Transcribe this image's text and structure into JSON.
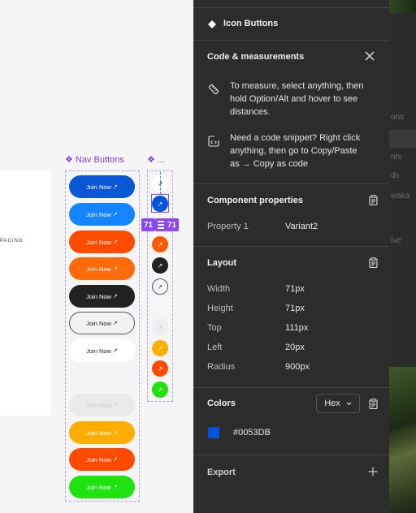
{
  "canvas": {
    "spacing_label": "PACING",
    "nav_frame_label": "Nav Buttons",
    "icon_frame_label": "...",
    "frame_glyph": "❖",
    "nav_buttons": [
      {
        "label": "Join Now",
        "bg": "#0a57d6",
        "fg": "#ffffff",
        "border": "none"
      },
      {
        "label": "Join Now",
        "bg": "#1585ff",
        "fg": "#ffffff",
        "border": "none"
      },
      {
        "label": "Join Now",
        "bg": "#ff4c00",
        "fg": "#ffffff",
        "border": "none"
      },
      {
        "label": "Join Now",
        "bg": "#ff6a0a",
        "fg": "#ffffff",
        "border": "none"
      },
      {
        "label": "Join Now",
        "bg": "#222222",
        "fg": "#ffffff",
        "border": "none"
      },
      {
        "label": "Join Now",
        "bg": "#f2f2f2",
        "fg": "#222222",
        "border": "1px solid #555555"
      },
      {
        "label": "Join Now",
        "bg": "#ffffff",
        "fg": "#222222",
        "border": "none"
      },
      {
        "label": "Join Now",
        "bg": "#f4f4f4",
        "fg": "#f9f9f9",
        "border": "none"
      },
      {
        "label": "Join Now",
        "bg": "#eaeaea",
        "fg": "#c8c8c8",
        "border": "none"
      },
      {
        "label": "Join Now",
        "bg": "#ffae00",
        "fg": "#ffffff",
        "border": "none"
      },
      {
        "label": "Join Now",
        "bg": "#ff4a00",
        "fg": "#ffffff",
        "border": "none"
      },
      {
        "label": "Join Now",
        "bg": "#1fe20f",
        "fg": "#ffffff",
        "border": "none"
      }
    ],
    "icon_buttons": [
      {
        "bg": "#ffffff",
        "fg": "#222222",
        "border": "none"
      },
      {
        "bg": "#0053db",
        "fg": "#ffffff",
        "border": "none"
      },
      {
        "bg": "#ff5a00",
        "fg": "#ffffff",
        "border": "none"
      },
      {
        "bg": "#222222",
        "fg": "#ffffff",
        "border": "none"
      },
      {
        "bg": "#f5f5f5",
        "fg": "#444444",
        "border": "1px solid #555555"
      },
      {
        "bg": "#f7f7f7",
        "fg": "#f7f7f7",
        "border": "none"
      },
      {
        "bg": "#eeeeee",
        "fg": "#c8c8c8",
        "border": "none"
      },
      {
        "bg": "#ffae00",
        "fg": "#ffffff",
        "border": "none"
      },
      {
        "bg": "#ff4a00",
        "fg": "#ffffff",
        "border": "none"
      },
      {
        "bg": "#1fe20f",
        "fg": "#ffffff",
        "border": "none"
      }
    ],
    "arrow_glyph": "↗",
    "measure_tags": [
      "71",
      "71"
    ]
  },
  "panel": {
    "component_title": "Icon Buttons",
    "code_section": {
      "title": "Code & measurements",
      "tip1": [
        "To measure, select anything, then",
        "hold Option/Alt and hover to see",
        "distances."
      ],
      "tip2": [
        "Need a code snippet? Right click",
        "anything, then go to Copy/Paste",
        "as → Copy as code"
      ]
    },
    "component_properties": {
      "title": "Component properties",
      "property_label": "Property 1",
      "property_value": "Variant2"
    },
    "layout": {
      "title": "Layout",
      "rows": [
        {
          "label": "Width",
          "value": "71px"
        },
        {
          "label": "Height",
          "value": "71px"
        },
        {
          "label": "Top",
          "value": "111px"
        },
        {
          "label": "Left",
          "value": "20px"
        },
        {
          "label": "Radius",
          "value": "900px"
        }
      ]
    },
    "colors": {
      "title": "Colors",
      "format": "Hex",
      "swatch_hex": "#0053DB",
      "swatch_color": "#0053db"
    },
    "export": {
      "title": "Export"
    }
  },
  "background_app": {
    "fragments": [
      "ons",
      "nts",
      "ds",
      "waka",
      "ive"
    ]
  }
}
